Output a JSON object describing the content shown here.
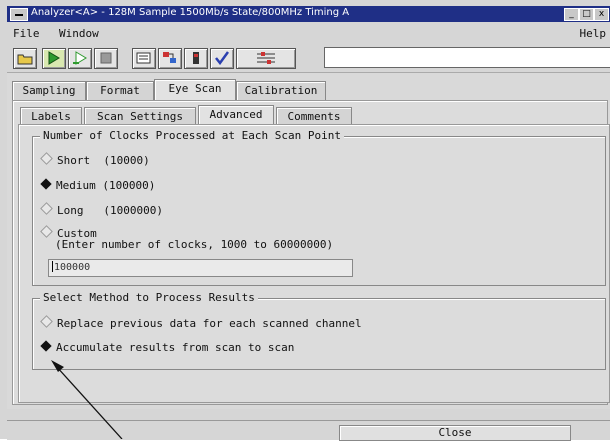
{
  "window": {
    "title": "Analyzer<A> - 128M Sample 1500Mb/s State/800MHz Timing A",
    "min_label": "_",
    "max_label": "□",
    "close_label": "x"
  },
  "menu": {
    "file": "File",
    "window": "Window",
    "help": "Help"
  },
  "toolbar": {
    "icons": [
      "open-folder-icon",
      "run-single-icon",
      "run-repetitive-icon",
      "stop-icon",
      "list-view-icon",
      "config-icon",
      "marker-icon",
      "check-icon",
      "setup-icon"
    ]
  },
  "tabs": {
    "sampling": "Sampling",
    "format": "Format",
    "eye_scan": "Eye Scan",
    "calibration": "Calibration"
  },
  "subtabs": {
    "labels": "Labels",
    "scan_settings": "Scan Settings",
    "advanced": "Advanced",
    "comments": "Comments"
  },
  "clocks_group": {
    "title": "Number of Clocks Processed at Each Scan Point",
    "options": [
      {
        "label": "Short  (10000)",
        "selected": false
      },
      {
        "label": "Medium (100000)",
        "selected": true
      },
      {
        "label": "Long   (1000000)",
        "selected": false
      },
      {
        "label": "Custom",
        "selected": false
      }
    ],
    "custom_hint": "(Enter number of clocks, 1000 to 60000000)",
    "custom_value": "100000"
  },
  "method_group": {
    "title": "Select Method to Process Results",
    "options": [
      {
        "label": "Replace previous data for each scanned channel",
        "selected": false
      },
      {
        "label": "Accumulate results from scan to scan",
        "selected": true
      }
    ]
  },
  "footer": {
    "close_label": "Close"
  }
}
